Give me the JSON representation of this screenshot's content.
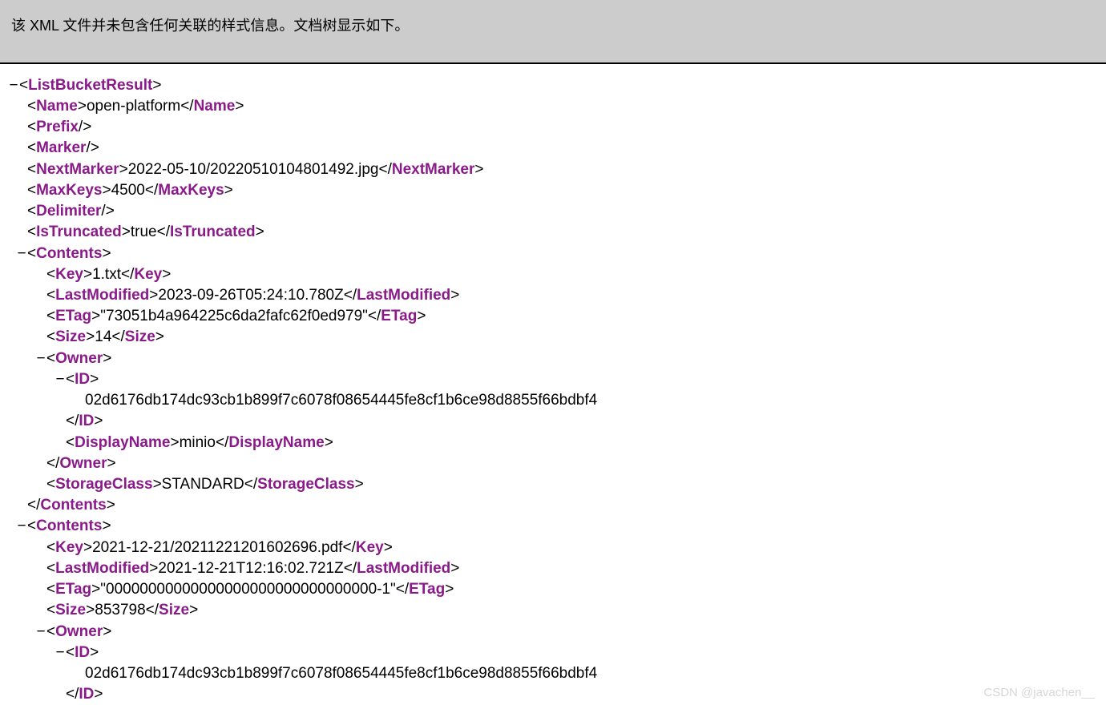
{
  "header": {
    "notice": "该 XML 文件并未包含任何关联的样式信息。文档树显示如下。"
  },
  "xml": {
    "root": "ListBucketResult",
    "name": {
      "tag": "Name",
      "value": "open-platform"
    },
    "prefix": {
      "tag": "Prefix"
    },
    "marker": {
      "tag": "Marker"
    },
    "nextMarker": {
      "tag": "NextMarker",
      "value": "2022-05-10/20220510104801492.jpg"
    },
    "maxKeys": {
      "tag": "MaxKeys",
      "value": "4500"
    },
    "delimiter": {
      "tag": "Delimiter"
    },
    "isTruncated": {
      "tag": "IsTruncated",
      "value": "true"
    },
    "contents1": {
      "open": "Contents",
      "key": {
        "tag": "Key",
        "value": "1.txt"
      },
      "lastModified": {
        "tag": "LastModified",
        "value": "2023-09-26T05:24:10.780Z"
      },
      "etag": {
        "tag": "ETag",
        "value": "\"73051b4a964225c6da2fafc62f0ed979\""
      },
      "size": {
        "tag": "Size",
        "value": "14"
      },
      "owner": {
        "open": "Owner",
        "id": {
          "tag": "ID",
          "value": "02d6176db174dc93cb1b899f7c6078f08654445fe8cf1b6ce98d8855f66bdbf4"
        },
        "displayName": {
          "tag": "DisplayName",
          "value": "minio"
        }
      },
      "storageClass": {
        "tag": "StorageClass",
        "value": "STANDARD"
      }
    },
    "contents2": {
      "open": "Contents",
      "key": {
        "tag": "Key",
        "value": "2021-12-21/20211221201602696.pdf"
      },
      "lastModified": {
        "tag": "LastModified",
        "value": "2021-12-21T12:16:02.721Z"
      },
      "etag": {
        "tag": "ETag",
        "value": "\"00000000000000000000000000000000-1\""
      },
      "size": {
        "tag": "Size",
        "value": "853798"
      },
      "owner": {
        "open": "Owner",
        "id": {
          "tag": "ID",
          "value": "02d6176db174dc93cb1b899f7c6078f08654445fe8cf1b6ce98d8855f66bdbf4"
        }
      }
    }
  },
  "watermark": "CSDN @javachen__"
}
